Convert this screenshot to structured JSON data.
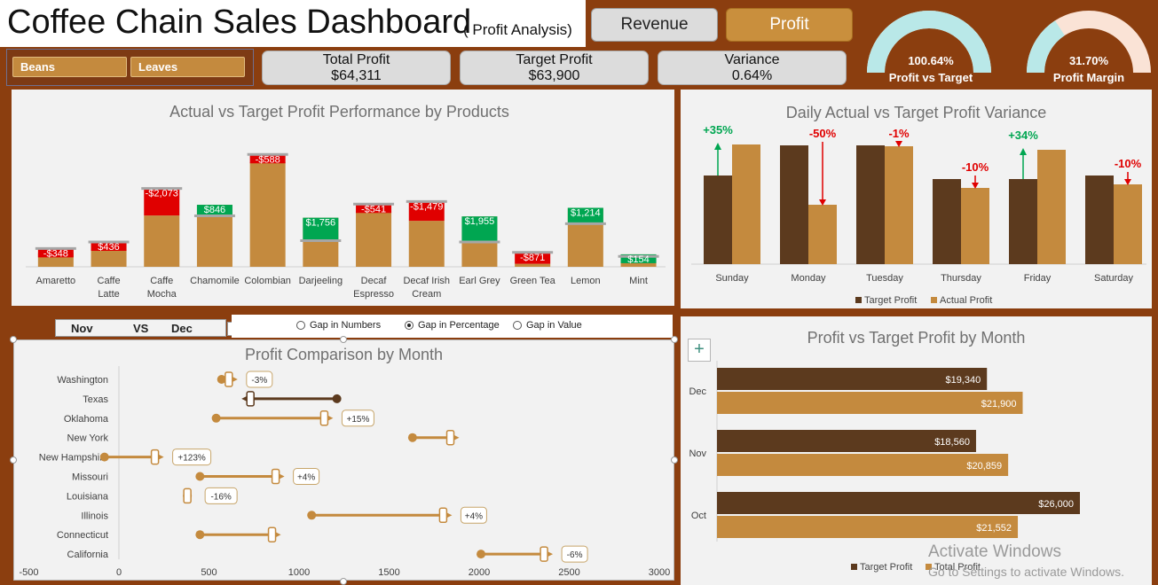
{
  "header": {
    "title": "Coffee Chain Sales Dashboard",
    "subtitle": "( Profit Analysis)"
  },
  "toggles": {
    "revenue": "Revenue",
    "profit": "Profit"
  },
  "slicer": {
    "items": [
      "Beans",
      "Leaves"
    ]
  },
  "kpis": [
    {
      "label": "Total Profit",
      "value": "$64,311"
    },
    {
      "label": "Target Profit",
      "value": "$63,900"
    },
    {
      "label": "Variance",
      "value": "0.64%"
    }
  ],
  "gauges": [
    {
      "value": "100.64%",
      "label": "Profit vs Target",
      "fraction": 1.0
    },
    {
      "value": "31.70%",
      "label": "Profit Margin",
      "fraction": 0.317
    }
  ],
  "colors": {
    "dark": "#5C3A1E",
    "gold": "#C48A3E",
    "up": "#00A651",
    "down": "#E00000",
    "page": "#8B3E0F",
    "panel": "#F2F2F2"
  },
  "chart_data": [
    {
      "type": "bar",
      "title": "Actual vs Target Profit Performance by Products",
      "categories": [
        "Amaretto",
        "Caffe Latte",
        "Caffe Mocha",
        "Chamomile",
        "Colombian",
        "Darjeeling",
        "Decaf Espresso",
        "Decaf Irish Cream",
        "Earl Grey",
        "Green Tea",
        "Lemon",
        "Mint"
      ],
      "series": [
        {
          "name": "Actual",
          "values": [
            1052,
            1336,
            3927,
            4746,
            8012,
            3756,
            4259,
            3521,
            3855,
            229,
            4514,
            954
          ]
        },
        {
          "name": "Target",
          "values": [
            1400,
            1900,
            6000,
            3900,
            8600,
            2000,
            4800,
            5000,
            1900,
            1100,
            3300,
            800
          ]
        }
      ],
      "variance_labels": [
        "-$348",
        "$436",
        "-$2,073",
        "$846",
        "-$588",
        "$1,756",
        "-$541",
        "-$1,479",
        "$1,955",
        "-$871",
        "$1,214",
        "$154"
      ],
      "ylim": [
        0,
        9500
      ]
    },
    {
      "type": "bar",
      "title": "Daily Actual vs Target  Profit Variance",
      "categories": [
        "Sunday",
        "Monday",
        "Tuesday",
        "Thursday",
        "Friday",
        "Saturday"
      ],
      "series": [
        {
          "name": "Target Profit",
          "values": [
            100,
            134,
            134,
            96,
            96,
            100
          ]
        },
        {
          "name": "Actual Profit",
          "values": [
            135,
            67,
            133,
            86,
            129,
            90
          ]
        }
      ],
      "variance_labels": [
        "+35%",
        "-50%",
        "-1%",
        "-10%",
        "+34%",
        "-10%"
      ],
      "ylim": [
        0,
        150
      ]
    },
    {
      "type": "scatter",
      "title": "Profit Comparison by Month",
      "period_labels": [
        "Nov",
        "VS",
        "Dec"
      ],
      "options": [
        {
          "label": "Gap in Numbers",
          "selected": false
        },
        {
          "label": "Gap in Percentage",
          "selected": true
        },
        {
          "label": "Gap in Value",
          "selected": false
        }
      ],
      "categories": [
        "Washington",
        "Texas",
        "Oklahoma",
        "New York",
        "New Hampshire",
        "Missouri",
        "Louisiana",
        "Illinois",
        "Connecticut",
        "California"
      ],
      "series": [
        {
          "name": "Nov",
          "values": [
            570,
            1210,
            540,
            1630,
            -80,
            450,
            380,
            1070,
            450,
            2010
          ]
        },
        {
          "name": "Dec",
          "values": [
            610,
            730,
            1140,
            1840,
            200,
            870,
            380,
            1800,
            850,
            2360
          ]
        }
      ],
      "gap_labels": [
        "-3%",
        "",
        "+15%",
        "",
        "+123%",
        "+4%",
        "-16%",
        "+4%",
        "",
        "-6%"
      ],
      "xticks": [
        "-500",
        "0",
        "500",
        "1000",
        "1500",
        "2000",
        "2500",
        "3000"
      ],
      "xlim": [
        -500,
        3000
      ]
    },
    {
      "type": "bar",
      "title": "Profit vs Target Profit by Month",
      "categories": [
        "Dec",
        "Nov",
        "Oct"
      ],
      "series": [
        {
          "name": "Target Profit",
          "values": [
            19340,
            18560,
            26000
          ]
        },
        {
          "name": "Total Profit",
          "values": [
            21900,
            20859,
            21552
          ]
        }
      ],
      "value_labels": [
        [
          "$19,340",
          "$21,900"
        ],
        [
          "$18,560",
          "$20,859"
        ],
        [
          "$26,000",
          "$21,552"
        ]
      ],
      "xlim": [
        0,
        28000
      ]
    }
  ],
  "watermark": {
    "line1": "Activate Windows",
    "line2": "Go to Settings to activate Windows."
  }
}
